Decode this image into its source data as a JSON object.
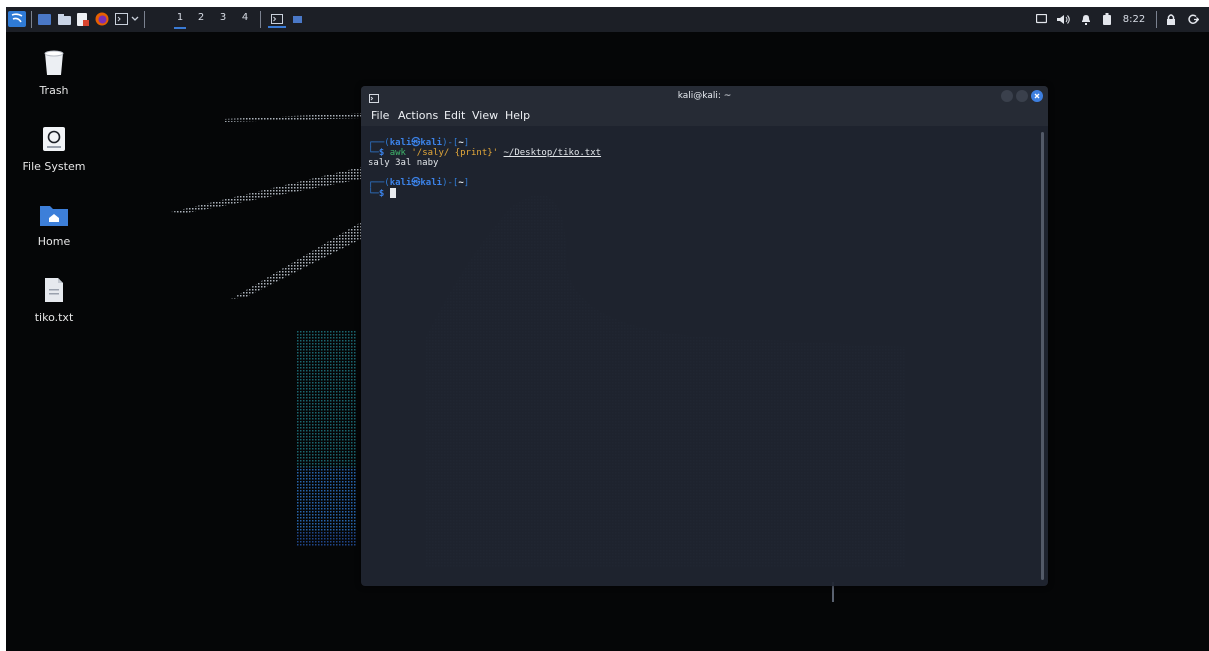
{
  "panel": {
    "workspaces": [
      "1",
      "2",
      "3",
      "4"
    ],
    "clock": "8:22"
  },
  "desktop_icons": [
    {
      "label": "Trash"
    },
    {
      "label": "File System"
    },
    {
      "label": "Home"
    },
    {
      "label": "tiko.txt"
    }
  ],
  "terminal": {
    "title": "kali@kali: ~",
    "menu": [
      "File",
      "Actions",
      "Edit",
      "View",
      "Help"
    ],
    "prompt_user": "kali",
    "prompt_at": "㉿",
    "prompt_host": "kali",
    "prompt_dir": "~",
    "command_name": "awk",
    "command_arg": "'/saly/ {print}'",
    "command_path": "~/Desktop/tiko.txt",
    "output": "saly 3al naby"
  },
  "colors": {
    "panel_bg": "#1c1f26",
    "terminal_bg": "#202632",
    "accent_blue": "#2f7bd6",
    "string_orange": "#e3a83a"
  }
}
